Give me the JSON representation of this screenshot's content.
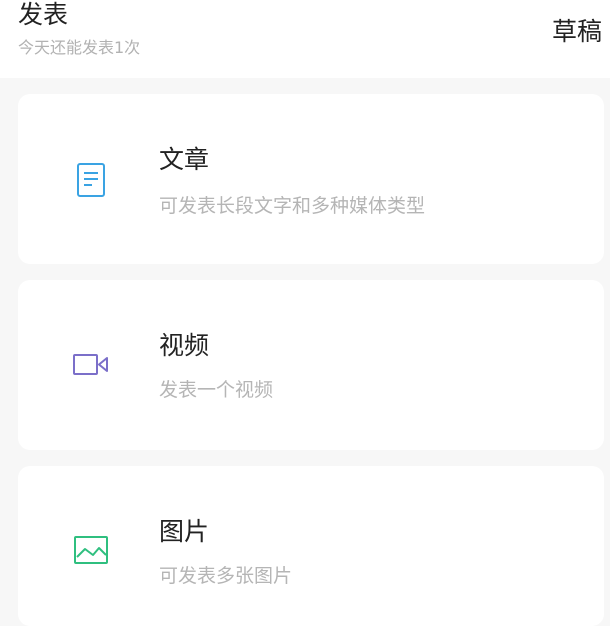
{
  "header": {
    "title": "发表",
    "subtitle": "今天还能发表1次",
    "drafts_label": "草稿"
  },
  "cards": [
    {
      "title": "文章",
      "description": "可发表长段文字和多种媒体类型",
      "icon": "document-icon",
      "icon_color": "#3aa3e3"
    },
    {
      "title": "视频",
      "description": "发表一个视频",
      "icon": "video-camera-icon",
      "icon_color": "#7b6fc9"
    },
    {
      "title": "图片",
      "description": "可发表多张图片",
      "icon": "image-icon",
      "icon_color": "#2fbf7f"
    }
  ]
}
